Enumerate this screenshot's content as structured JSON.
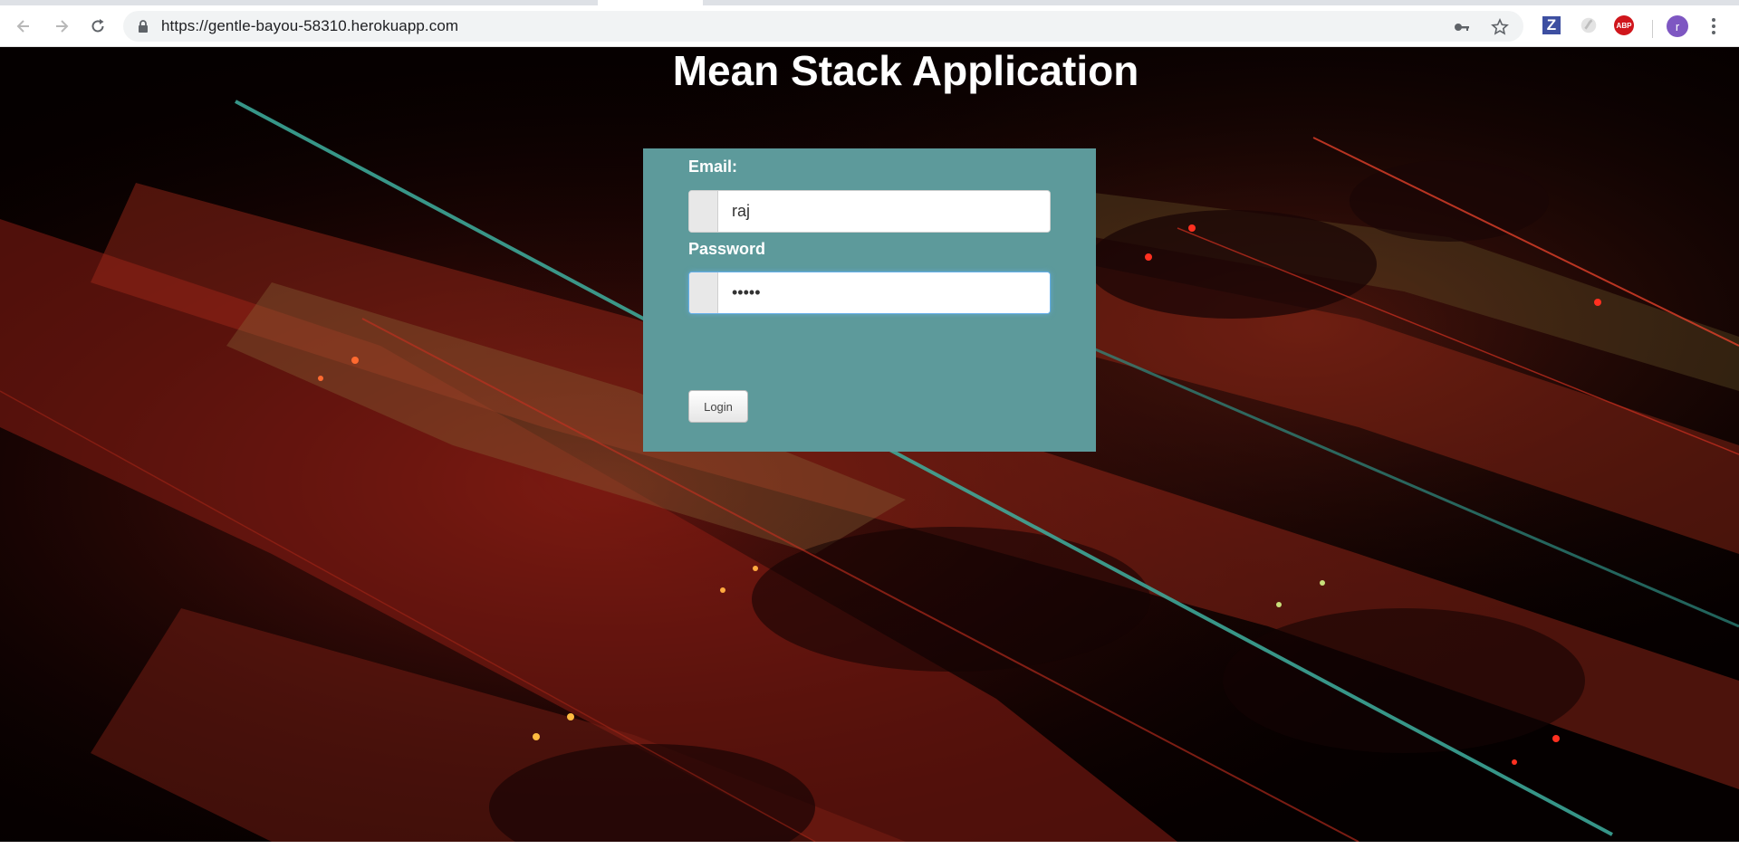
{
  "browser": {
    "url": "https://gentle-bayou-58310.herokuapp.com",
    "profile_initial": "r",
    "extensions": [
      "zotero-icon",
      "extension-icon",
      "adblock-icon"
    ],
    "extension_labels": {
      "z": "Z",
      "abp": "ABP"
    }
  },
  "page": {
    "title": "Mean Stack Application",
    "email_label": "Email:",
    "email_value": "raj",
    "password_label": "Password",
    "password_value": "•••••",
    "login_label": "Login"
  },
  "colors": {
    "panel": "#5d9a9b",
    "background": "#050000",
    "title": "#ffffff"
  }
}
